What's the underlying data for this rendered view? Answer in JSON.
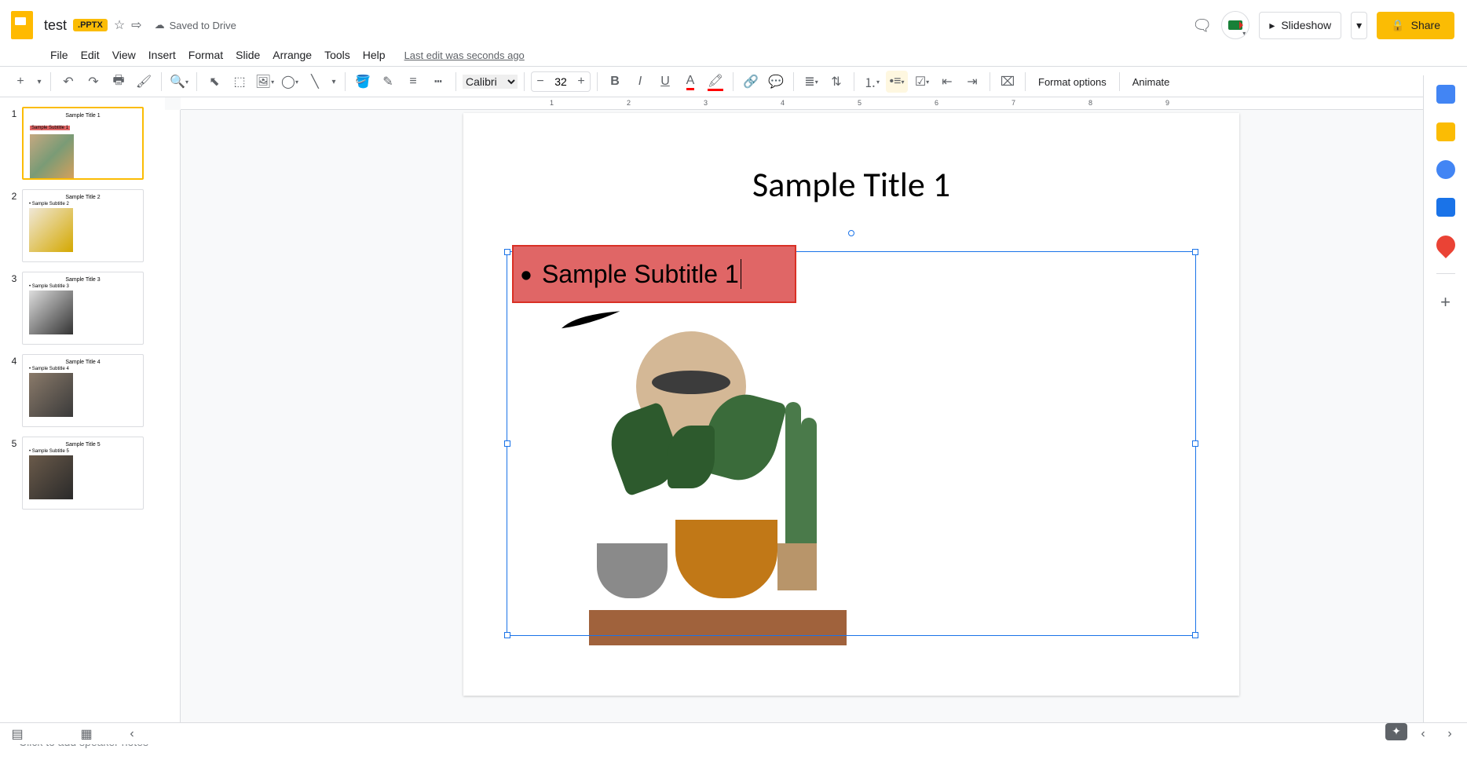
{
  "header": {
    "doc_title": "test",
    "badge": ".PPTX",
    "save_status": "Saved to Drive",
    "slideshow": "Slideshow",
    "share": "Share"
  },
  "menu": {
    "file": "File",
    "edit": "Edit",
    "view": "View",
    "insert": "Insert",
    "format": "Format",
    "slide": "Slide",
    "arrange": "Arrange",
    "tools": "Tools",
    "help": "Help",
    "last_edit": "Last edit was seconds ago"
  },
  "toolbar": {
    "font": "Calibri",
    "font_size": "32",
    "format_options": "Format options",
    "animate": "Animate"
  },
  "slides": [
    {
      "num": "1",
      "title": "Sample Title 1",
      "subtitle": "Sample Subtitle 1",
      "active": true,
      "highlight": true
    },
    {
      "num": "2",
      "title": "Sample Title 2",
      "subtitle": "• Sample Subtitle 2",
      "active": false,
      "highlight": false
    },
    {
      "num": "3",
      "title": "Sample Title 3",
      "subtitle": "• Sample Subtitle 3",
      "active": false,
      "highlight": false
    },
    {
      "num": "4",
      "title": "Sample Title 4",
      "subtitle": "• Sample Subtitle 4",
      "active": false,
      "highlight": false
    },
    {
      "num": "5",
      "title": "Sample Title 5",
      "subtitle": "• Sample Subtitle 5",
      "active": false,
      "highlight": false
    }
  ],
  "canvas": {
    "title": "Sample Title 1",
    "subtitle": "Sample Subtitle 1"
  },
  "notes": {
    "placeholder": "Click to add speaker notes"
  },
  "ruler": {
    "marks": [
      "1",
      "2",
      "3",
      "4",
      "5",
      "6",
      "7",
      "8",
      "9"
    ]
  }
}
